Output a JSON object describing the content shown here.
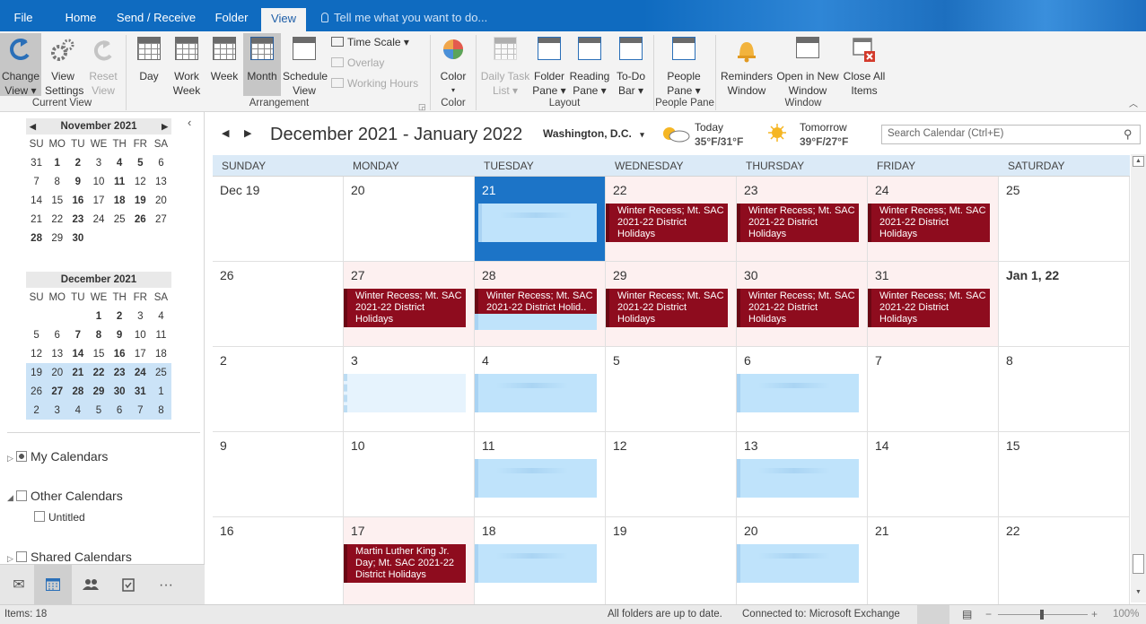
{
  "tabs": [
    {
      "label": "File"
    },
    {
      "label": "Home"
    },
    {
      "label": "Send / Receive"
    },
    {
      "label": "Folder"
    },
    {
      "label": "View",
      "active": true
    }
  ],
  "tell_me": "Tell me what you want to do...",
  "ribbon": {
    "change_view": "Change View ▾",
    "view_settings": "View Settings",
    "reset_view": "Reset View",
    "current_view_group": "Current View",
    "day": "Day",
    "work_week": "Work Week",
    "week": "Week",
    "month": "Month",
    "schedule_view": "Schedule View",
    "time_scale": "Time Scale ▾",
    "overlay": "Overlay",
    "working_hours": "Working Hours",
    "arrangement_group": "Arrangement",
    "color": "Color",
    "color_group": "Color",
    "daily_task_list": "Daily Task List ▾",
    "folder_pane": "Folder Pane ▾",
    "reading_pane": "Reading Pane ▾",
    "todo_bar": "To-Do Bar ▾",
    "layout_group": "Layout",
    "people_pane": "People Pane ▾",
    "people_pane_group": "People Pane",
    "reminders_window": "Reminders Window",
    "open_new_window": "Open in New Window",
    "close_all_items": "Close All Items",
    "window_group": "Window"
  },
  "mini_nov": {
    "title": "November 2021",
    "days": [
      "SU",
      "MO",
      "TU",
      "WE",
      "TH",
      "FR",
      "SA"
    ],
    "weeks": [
      [
        "31",
        "1",
        "2",
        "3",
        "4",
        "5",
        "6"
      ],
      [
        "7",
        "8",
        "9",
        "10",
        "11",
        "12",
        "13"
      ],
      [
        "14",
        "15",
        "16",
        "17",
        "18",
        "19",
        "20"
      ],
      [
        "21",
        "22",
        "23",
        "24",
        "25",
        "26",
        "27"
      ],
      [
        "28",
        "29",
        "30",
        "",
        "",
        "",
        ""
      ]
    ]
  },
  "mini_dec": {
    "title": "December 2021",
    "days": [
      "SU",
      "MO",
      "TU",
      "WE",
      "TH",
      "FR",
      "SA"
    ],
    "weeks": [
      [
        "",
        "",
        "",
        "1",
        "2",
        "3",
        "4"
      ],
      [
        "5",
        "6",
        "7",
        "8",
        "9",
        "10",
        "11"
      ],
      [
        "12",
        "13",
        "14",
        "15",
        "16",
        "17",
        "18"
      ],
      [
        "19",
        "20",
        "21",
        "22",
        "23",
        "24",
        "25"
      ],
      [
        "26",
        "27",
        "28",
        "29",
        "30",
        "31",
        "1"
      ],
      [
        "2",
        "3",
        "4",
        "5",
        "6",
        "7",
        "8"
      ]
    ]
  },
  "folders": {
    "my_calendars": "My Calendars",
    "other_calendars": "Other Calendars",
    "untitled": "Untitled",
    "shared_calendars": "Shared Calendars"
  },
  "header": {
    "range": "December 2021 - January 2022",
    "location": "Washington, D.C.",
    "today_label": "Today",
    "today_temp": "35°F/31°F",
    "tomorrow_label": "Tomorrow",
    "tomorrow_temp": "39°F/27°F",
    "search_placeholder": "Search Calendar (Ctrl+E)"
  },
  "day_names": [
    "SUNDAY",
    "MONDAY",
    "TUESDAY",
    "WEDNESDAY",
    "THURSDAY",
    "FRIDAY",
    "SATURDAY"
  ],
  "weeks": [
    [
      "Dec 19",
      "20",
      "21",
      "22",
      "23",
      "24",
      "25"
    ],
    [
      "26",
      "27",
      "28",
      "29",
      "30",
      "31",
      "Jan 1, 22"
    ],
    [
      "2",
      "3",
      "4",
      "5",
      "6",
      "7",
      "8"
    ],
    [
      "9",
      "10",
      "11",
      "12",
      "13",
      "14",
      "15"
    ],
    [
      "16",
      "17",
      "18",
      "19",
      "20",
      "21",
      "22"
    ]
  ],
  "events": {
    "winter": "Winter Recess; Mt. SAC 2021-22 District Holidays",
    "winter_short": "Winter Recess; Mt. SAC 2021-22 District Holid..",
    "mlk": "Martin Luther King Jr. Day; Mt. SAC 2021-22 District Holidays"
  },
  "status": {
    "items": "Items: 18",
    "sync": "All folders are up to date.",
    "connection": "Connected to: Microsoft Exchange",
    "zoom": "100%"
  },
  "colors": {
    "accent": "#0f6bc0",
    "event_red": "#8e0c1e",
    "event_blue": "#bfe3fb",
    "today": "#1c74c7"
  }
}
